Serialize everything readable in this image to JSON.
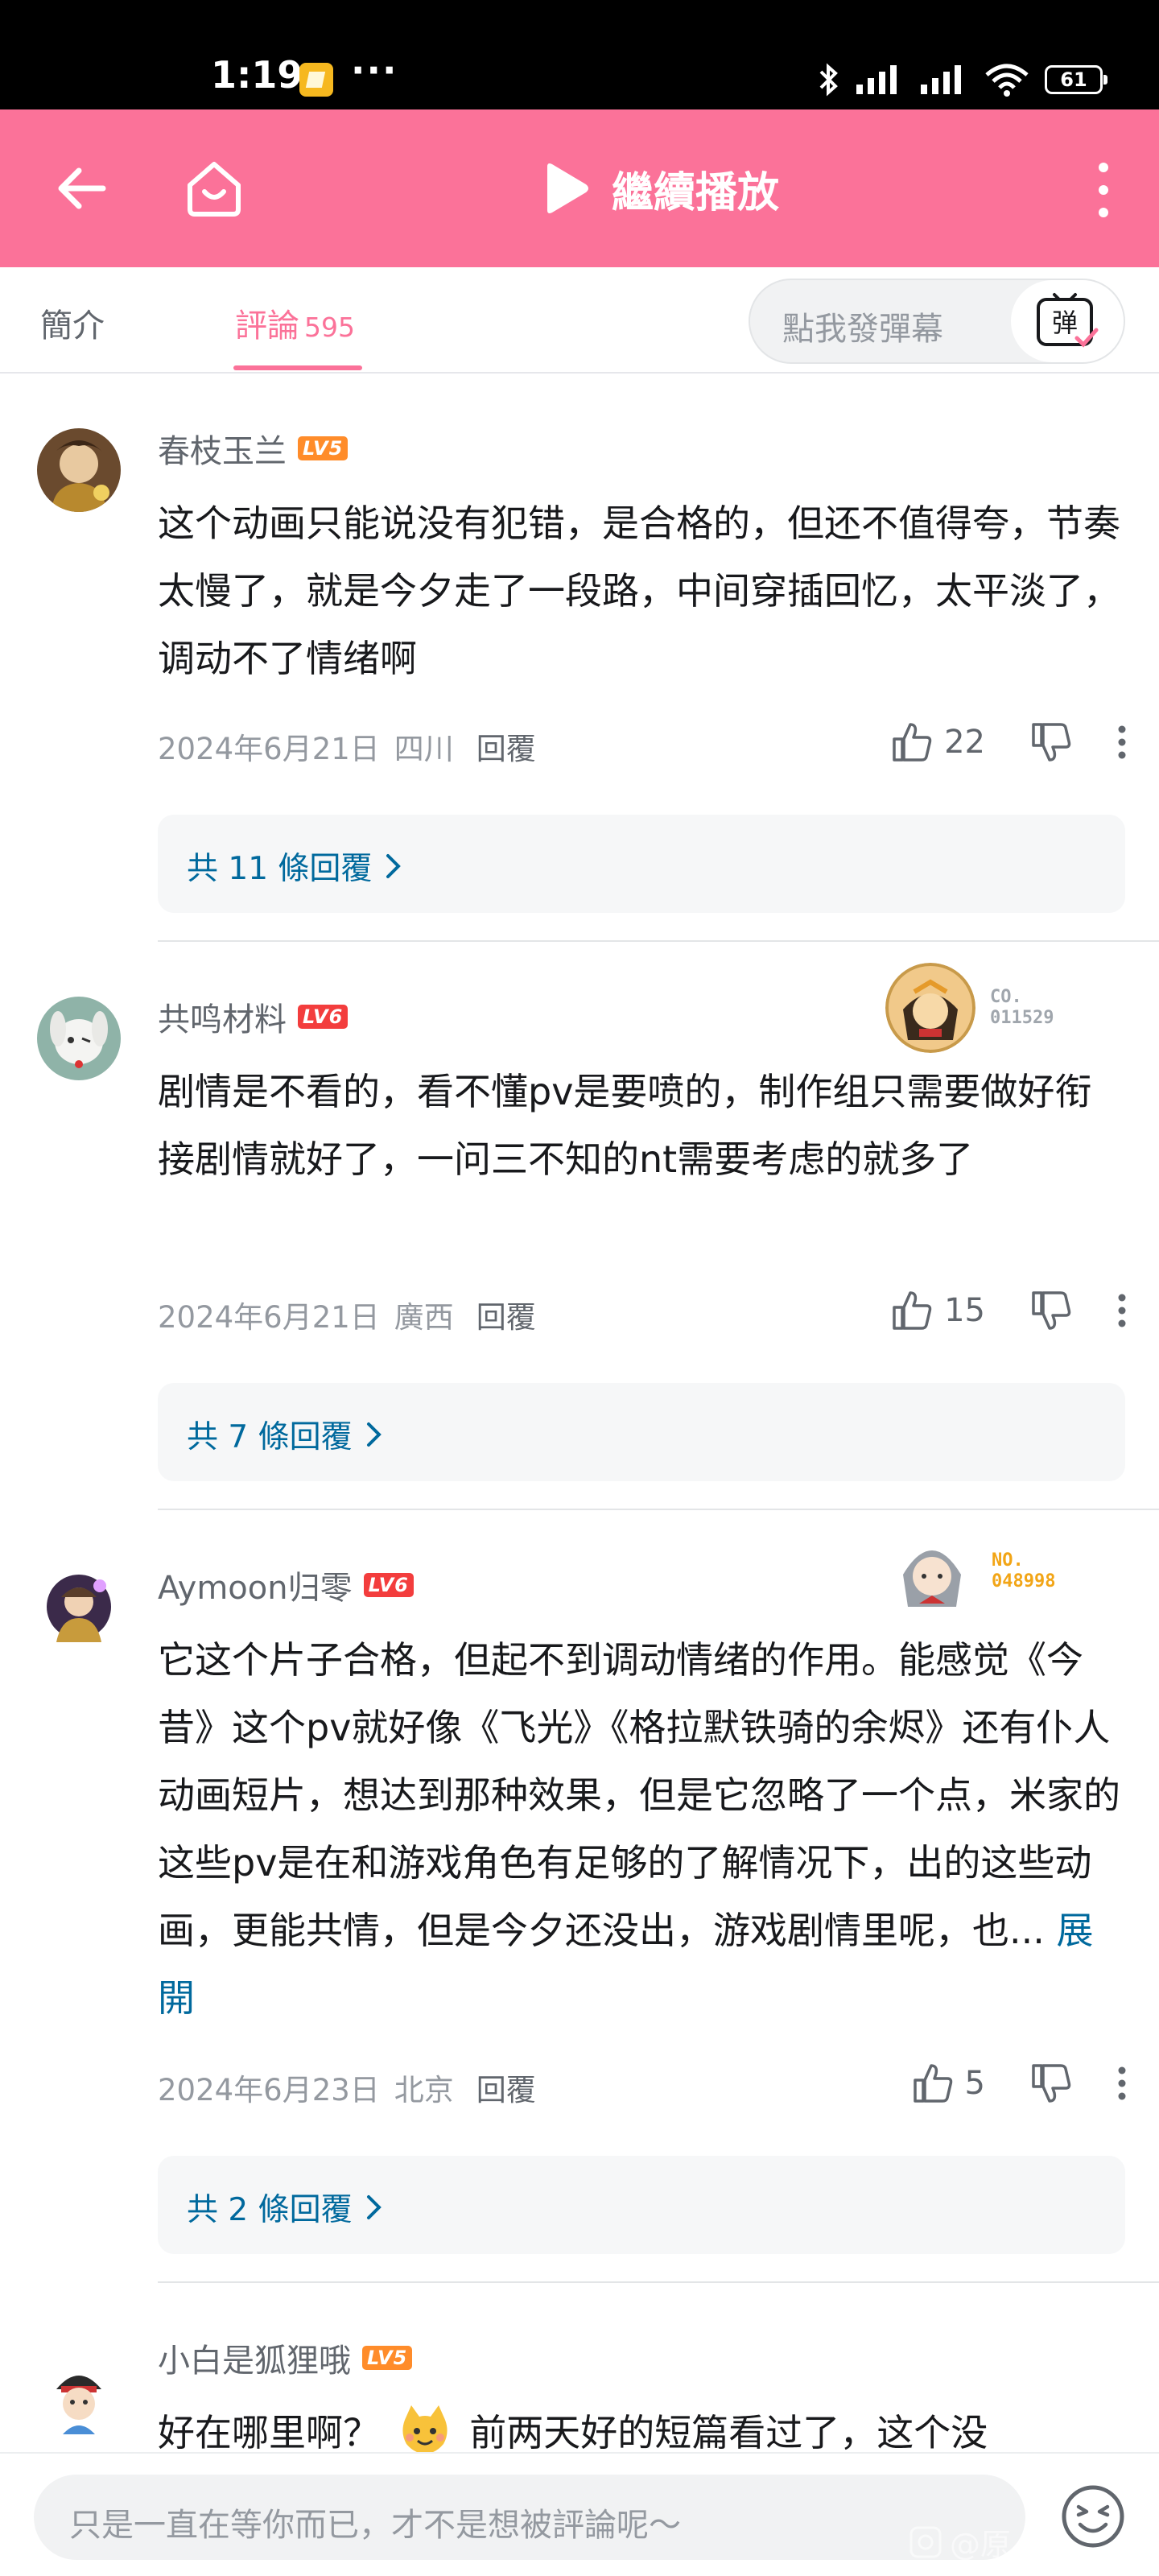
{
  "status_bar": {
    "time": "1:19",
    "dots": "···",
    "battery": "61"
  },
  "header": {
    "title": "繼續播放"
  },
  "tabs": [
    {
      "label": "簡介"
    },
    {
      "label": "評論",
      "count": "595"
    }
  ],
  "danmaku": {
    "placeholder": "點我發彈幕",
    "button_label": "弹"
  },
  "comments": [
    {
      "username": "春枝玉兰",
      "level": "LV5",
      "content": "这个动画只能说没有犯错，是合格的，但还不值得夸，节奏太慢了，就是今夕走了一段路，中间穿插回忆，太平淡了，调动不了情绪啊",
      "date": "2024年6月21日",
      "location": "四川",
      "reply_label": "回覆",
      "likes": "22",
      "replies": "共 11 條回覆"
    },
    {
      "username": "共鸣材料",
      "level": "LV6",
      "badge_no": "CO.\n011529",
      "content": "剧情是不看的，看不懂pv是要喷的，制作组只需要做好衔接剧情就好了，一问三不知的nt需要考虑的就多了",
      "date": "2024年6月21日",
      "location": "廣西",
      "reply_label": "回覆",
      "likes": "15",
      "replies": "共 7 條回覆"
    },
    {
      "username": "Aymoon归零",
      "level": "LV6",
      "badge_no": "NO.\n048998",
      "content": "它这个片子合格，但起不到调动情绪的作用。能感觉《今昔》这个pv就好像《飞光》《格拉默铁骑的余烬》还有仆人动画短片，想达到那种效果，但是它忽略了一个点，米家的这些pv是在和游戏角色有足够的了解情况下，出的这些动画，更能共情，但是今夕还没出，游戏剧情里呢，也...",
      "expand_label": "展開",
      "date": "2024年6月23日",
      "location": "北京",
      "reply_label": "回覆",
      "likes": "5",
      "replies": "共 2 條回覆"
    },
    {
      "username": "小白是狐狸哦",
      "level": "LV5",
      "content_before": "好在哪里啊？",
      "content_after": "前两天好的短篇看过了，这个没"
    }
  ],
  "bottom": {
    "placeholder": "只是一直在等你而已，才不是想被評論呢～",
    "watermark": "@原"
  },
  "colors": {
    "brand_pink": "#fb7299",
    "link_blue": "#00699d",
    "lv5": "#ff8c2a",
    "lv6": "#f33d3d"
  },
  "icons": [
    "back-arrow-icon",
    "home-icon",
    "play-icon",
    "more-vertical-icon",
    "danmaku-icon",
    "thumb-up-icon",
    "thumb-down-icon",
    "chevron-right-icon",
    "emoji-icon",
    "bluetooth-icon",
    "signal-icon",
    "wifi-icon"
  ]
}
